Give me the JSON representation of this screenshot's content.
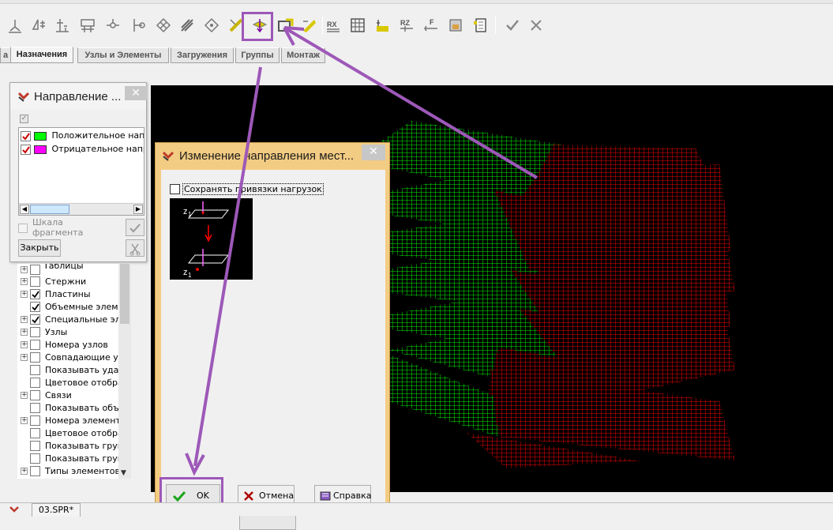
{
  "toolbar": {
    "icons": [
      "support-icon",
      "fixings-icon",
      "axis-icon",
      "grid-icon",
      "hinge-icon",
      "pin-icon",
      "mesh-icon",
      "stiffness-icon",
      "rigid-icon",
      "material-icon",
      "local-axis-icon",
      "change-direction-icon",
      "orient-icon",
      "color-icon",
      "grid-table-icon",
      "fill-icon",
      "rz-icon",
      "r-icon",
      "f-icon",
      "print-icon",
      "table-icon",
      "apply-icon",
      "cancel-icon"
    ]
  },
  "tabs": [
    "а",
    "Назначения",
    "Узлы и Элементы",
    "Загружения",
    "Группы",
    "Монтаж"
  ],
  "panel": {
    "title": "Направление ...",
    "legend": [
      {
        "label": "Положительное напра",
        "color": "#00ff00"
      },
      {
        "label": "Отрицательное напра",
        "color": "#ff00ff"
      }
    ],
    "scale_label_1": "Шкала",
    "scale_label_2": "фрагмента",
    "close_button": "Закрыть"
  },
  "tree": [
    {
      "label": "Таблицы",
      "checked": false,
      "expand": true
    },
    {
      "label": "Стержни",
      "checked": false,
      "expand": true
    },
    {
      "label": "Пластины",
      "checked": true,
      "expand": true
    },
    {
      "label": "Объемные элеме",
      "checked": true,
      "expand": false
    },
    {
      "label": "Специальные эле",
      "checked": true,
      "expand": true
    },
    {
      "label": "Узлы",
      "checked": false,
      "expand": true
    },
    {
      "label": "Номера узлов",
      "checked": false,
      "expand": true
    },
    {
      "label": "Совпадающие узл",
      "checked": false,
      "expand": true
    },
    {
      "label": "Показывать удал",
      "checked": false,
      "expand": false
    },
    {
      "label": "Цветовое отобра",
      "checked": false,
      "expand": false
    },
    {
      "label": "Связи",
      "checked": false,
      "expand": true
    },
    {
      "label": "Показывать объе",
      "checked": false,
      "expand": false
    },
    {
      "label": "Номера элементо",
      "checked": false,
      "expand": true
    },
    {
      "label": "Цветовое отобра",
      "checked": false,
      "expand": false
    },
    {
      "label": "Показывать груп",
      "checked": false,
      "expand": false
    },
    {
      "label": "Показывать груп",
      "checked": false,
      "expand": false
    },
    {
      "label": "Типы элементов",
      "checked": false,
      "expand": true
    }
  ],
  "dialog": {
    "title": "Изменение направления мест...",
    "checkbox_label": "Сохранять привязки нагрузок",
    "axis_label_top": "z",
    "axis_sub_top": "1",
    "axis_label_bottom": "z",
    "axis_sub_bottom": "1",
    "ok": "OK",
    "cancel": "Отмена",
    "help": "Справка"
  },
  "statusbar": {
    "doc": "03.SPR*"
  },
  "colors": {
    "accent": "#9d58b8",
    "positive": "#00ff00",
    "negative": "#ff0000"
  }
}
